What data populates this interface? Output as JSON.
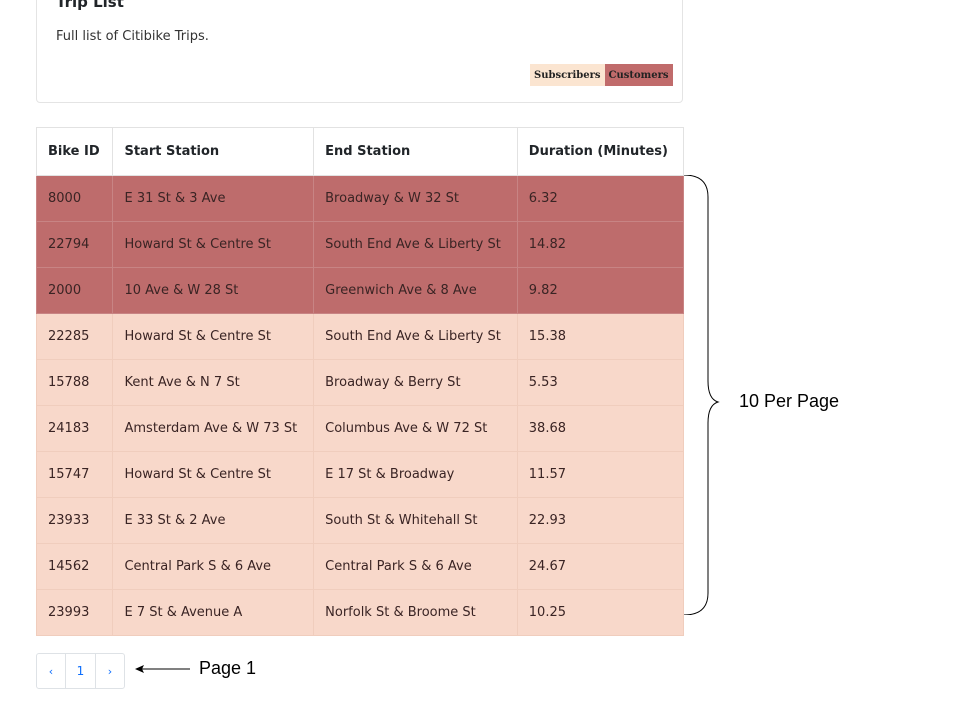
{
  "card": {
    "title": "Trip List",
    "subtitle": "Full list of Citibike Trips.",
    "legend": {
      "subscribers": "Subscribers",
      "customers": "Customers"
    }
  },
  "colors": {
    "customer_row": "#be6c6c",
    "subscriber_row": "#f8d8ca",
    "link": "#0d6efd"
  },
  "table": {
    "headers": [
      "Bike ID",
      "Start Station",
      "End Station",
      "Duration (Minutes)"
    ],
    "rows": [
      {
        "type": "customer",
        "bike_id": "8000",
        "start": "E 31 St & 3 Ave",
        "end": "Broadway & W 32 St",
        "duration": "6.32"
      },
      {
        "type": "customer",
        "bike_id": "22794",
        "start": "Howard St & Centre St",
        "end": "South End Ave & Liberty St",
        "duration": "14.82"
      },
      {
        "type": "customer",
        "bike_id": "2000",
        "start": "10 Ave & W 28 St",
        "end": "Greenwich Ave & 8 Ave",
        "duration": "9.82"
      },
      {
        "type": "subscriber",
        "bike_id": "22285",
        "start": "Howard St & Centre St",
        "end": "South End Ave & Liberty St",
        "duration": "15.38"
      },
      {
        "type": "subscriber",
        "bike_id": "15788",
        "start": "Kent Ave & N 7 St",
        "end": "Broadway & Berry St",
        "duration": "5.53"
      },
      {
        "type": "subscriber",
        "bike_id": "24183",
        "start": "Amsterdam Ave & W 73 St",
        "end": "Columbus Ave & W 72 St",
        "duration": "38.68"
      },
      {
        "type": "subscriber",
        "bike_id": "15747",
        "start": "Howard St & Centre St",
        "end": "E 17 St & Broadway",
        "duration": "11.57"
      },
      {
        "type": "subscriber",
        "bike_id": "23933",
        "start": "E 33 St & 2 Ave",
        "end": "South St & Whitehall St",
        "duration": "22.93"
      },
      {
        "type": "subscriber",
        "bike_id": "14562",
        "start": "Central Park S & 6 Ave",
        "end": "Central Park S & 6 Ave",
        "duration": "24.67"
      },
      {
        "type": "subscriber",
        "bike_id": "23993",
        "start": "E 7 St & Avenue A",
        "end": "Norfolk St & Broome St",
        "duration": "10.25"
      }
    ]
  },
  "pagination": {
    "prev": "‹",
    "current": "1",
    "next": "›"
  },
  "annotations": {
    "brace_label": "10 Per Page",
    "page_label": "Page 1"
  }
}
